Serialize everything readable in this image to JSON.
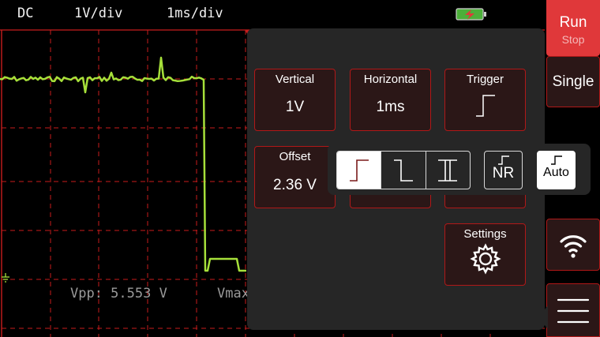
{
  "header": {
    "coupling": "DC",
    "volts_per_div": "1V/div",
    "time_per_div": "1ms/div"
  },
  "measurements": {
    "vpp": "Vpp: 5.553 V",
    "vmax": "Vmax"
  },
  "menu": {
    "vertical": {
      "title": "Vertical",
      "value": "1V"
    },
    "horizontal": {
      "title": "Horizontal",
      "value": "1ms"
    },
    "trigger": {
      "title": "Trigger"
    },
    "offset": {
      "title": "Offset",
      "value": "2.36 V"
    },
    "settings": {
      "title": "Settings"
    }
  },
  "trigger_popup": {
    "edge_options": [
      "rising-edge",
      "falling-edge",
      "both-edges"
    ],
    "selected_edge": "rising-edge",
    "nr_label": "NR",
    "auto_label": "Auto"
  },
  "sidebar": {
    "run_label": "Run",
    "stop_label": "Stop",
    "single_label": "Single"
  },
  "colors": {
    "accent": "#b01818",
    "trace": "#a6e03a",
    "grid": "#c81c1c",
    "run_bg": "#e0383a",
    "battery": "#4caf3a"
  },
  "icons": {
    "battery": "battery-charging-icon",
    "wifi": "wifi-icon",
    "menu": "hamburger-menu-icon",
    "settings": "gear-icon",
    "ground": "ground-marker-icon"
  }
}
